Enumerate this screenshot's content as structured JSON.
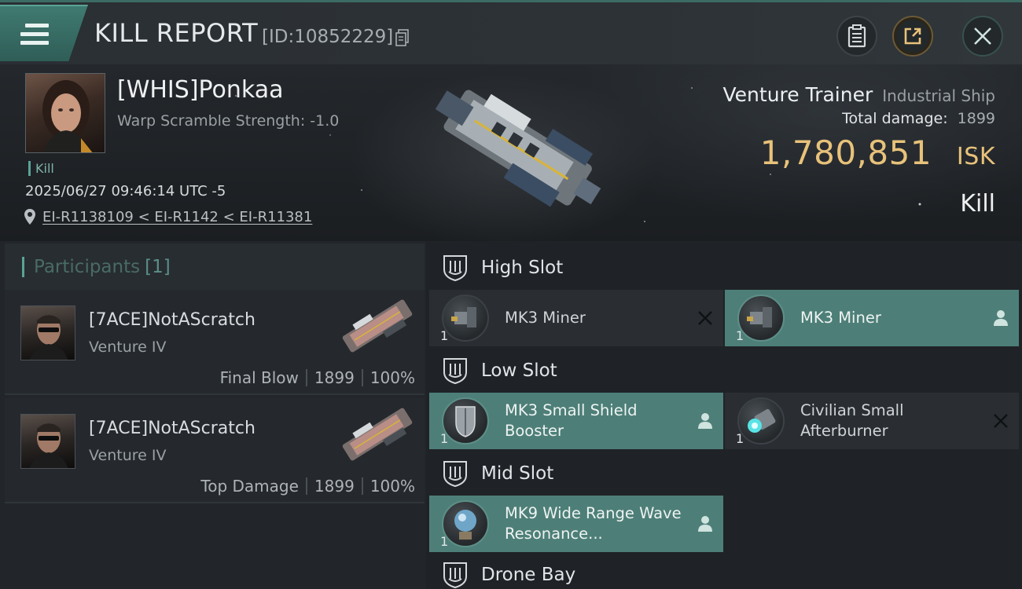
{
  "header": {
    "title": "KILL REPORT",
    "report_id": "[ID:10852229]"
  },
  "victim": {
    "name": "[WHIS]Ponkaa",
    "warp_scramble": "Warp Scramble Strength: -1.0",
    "tag": "Kill",
    "datetime": "2025/06/27 09:46:14 UTC -5",
    "location": "EI-R1138109 < EI-R1142 < EI-R11381",
    "ship_name": "Venture Trainer",
    "ship_class": "Industrial Ship",
    "total_damage_label": "Total damage:",
    "total_damage": "1899",
    "isk_value": "1,780,851",
    "isk_unit": "ISK",
    "result": "Kill"
  },
  "participants": {
    "label": "Participants",
    "count": "[1]",
    "rows": [
      {
        "name": "[7ACE]NotAScratch",
        "ship": "Venture IV",
        "role": "Final Blow",
        "damage": "1899",
        "percent": "100%"
      },
      {
        "name": "[7ACE]NotAScratch",
        "ship": "Venture IV",
        "role": "Top Damage",
        "damage": "1899",
        "percent": "100%"
      }
    ]
  },
  "slots": {
    "high": {
      "label": "High Slot",
      "modules": [
        {
          "name": "MK3 Miner",
          "qty": "1",
          "status": "destroyed"
        },
        {
          "name": "MK3 Miner",
          "qty": "1",
          "status": "dropped"
        }
      ]
    },
    "low": {
      "label": "Low Slot",
      "modules": [
        {
          "name": "MK3 Small Shield Booster",
          "qty": "1",
          "status": "dropped"
        },
        {
          "name": "Civilian Small Afterburner",
          "qty": "1",
          "status": "destroyed"
        }
      ]
    },
    "mid": {
      "label": "Mid Slot",
      "modules": [
        {
          "name": "MK9 Wide Range Wave Resonance...",
          "qty": "1",
          "status": "dropped"
        }
      ]
    },
    "drone": {
      "label": "Drone Bay"
    }
  },
  "colors": {
    "accent": "#5aa396",
    "isk": "#e8c27a",
    "dropped_bg": "#4d7f78",
    "destroyed_bg": "#2a2e32"
  }
}
